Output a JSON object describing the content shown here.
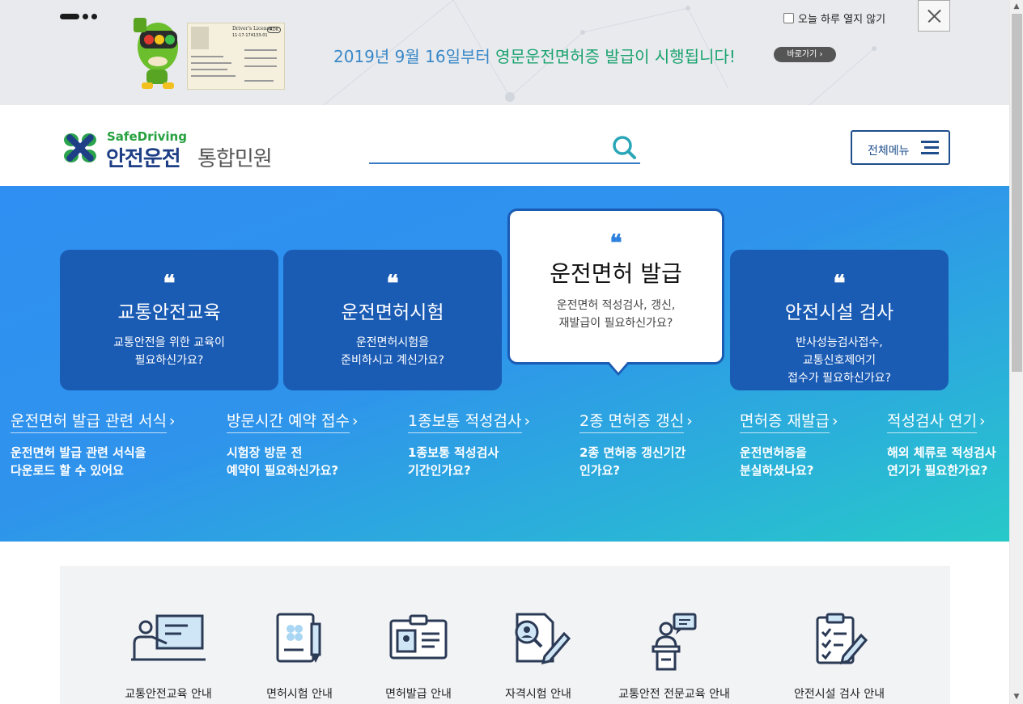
{
  "banner": {
    "notice_prefix": "2019년 9월 16일부터 ",
    "notice_highlight": "영문운전면허증 발급이 시행됩니다!",
    "goto_label": "바로가기 ›",
    "today_label": "오늘 하루 열지 않기",
    "license": {
      "title": "Driver's License",
      "country": "ROK",
      "number": "11-17-174133-01"
    }
  },
  "header": {
    "logo_top": "SafeDriving",
    "logo_main": "안전운전",
    "logo_sub": "통합민원",
    "search_placeholder": "",
    "allmenu_label": "전체메뉴"
  },
  "hero": {
    "quote_mark": "❝",
    "cards": [
      {
        "title": "교통안전교육",
        "desc1": "교통안전을 위한 교육이",
        "desc2": "필요하신가요?",
        "desc3": ""
      },
      {
        "title": "운전면허시험",
        "desc1": "운전면허시험을",
        "desc2": "준비하시고 계신가요?",
        "desc3": ""
      },
      {
        "title": "안전시설 검사",
        "desc1": "반사성능검사접수,",
        "desc2": "교통신호제어기",
        "desc3": "접수가 필요하신가요?"
      }
    ],
    "active_card": {
      "title": "운전면허 발급",
      "desc1": "운전면허 적성검사, 갱신,",
      "desc2": "재발급이 필요하신가요?"
    },
    "links": [
      {
        "title": "운전면허 발급 관련 서식",
        "desc1": "운전면허 발급 관련 서식을",
        "desc2": "다운로드 할 수 있어요"
      },
      {
        "title": "방문시간 예약 접수",
        "desc1": "시험장 방문 전",
        "desc2": "예약이 필요하신가요?"
      },
      {
        "title": "1종보통 적성검사",
        "desc1": "1종보통 적성검사",
        "desc2": "기간인가요?"
      },
      {
        "title": "2종 면허증 갱신",
        "desc1": "2종 면허증 갱신기간",
        "desc2": "인가요?"
      },
      {
        "title": "면허증 재발급",
        "desc1": "운전면허증을",
        "desc2": "분실하셨나요?"
      },
      {
        "title": "적성검사 연기",
        "desc1": "해외 체류로 적성검사",
        "desc2": "연기가 필요한가요?"
      }
    ],
    "arrow": "›"
  },
  "guide": {
    "items": [
      {
        "label": "교통안전교육 안내",
        "icon": "presentation-icon"
      },
      {
        "label": "면허시험 안내",
        "icon": "exam-document-icon"
      },
      {
        "label": "면허발급 안내",
        "icon": "id-card-icon"
      },
      {
        "label": "자격시험 안내",
        "icon": "qualification-test-icon"
      },
      {
        "label": "교통안전 전문교육 안내",
        "icon": "lecturer-podium-icon"
      },
      {
        "label": "안전시설 검사 안내",
        "icon": "checklist-clipboard-icon"
      }
    ]
  },
  "colors": {
    "primary": "#1a5bb4",
    "accent_green": "#1ba36f",
    "hero_start": "#2f8ff2",
    "hero_end": "#27c9c9"
  }
}
